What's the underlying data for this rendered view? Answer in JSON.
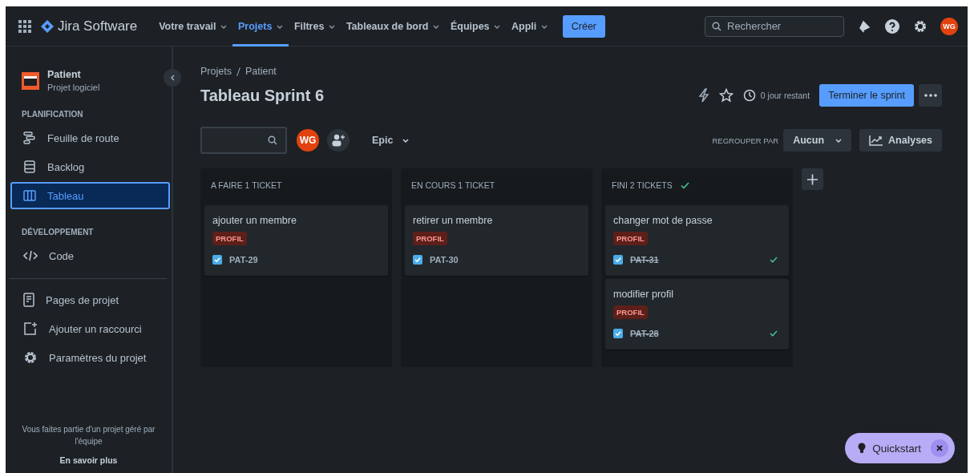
{
  "topbar": {
    "product": "Jira Software",
    "menus": [
      {
        "label": "Votre travail",
        "selected": false
      },
      {
        "label": "Projets",
        "selected": true
      },
      {
        "label": "Filtres",
        "selected": false
      },
      {
        "label": "Tableaux de bord",
        "selected": false
      },
      {
        "label": "Équipes",
        "selected": false
      },
      {
        "label": "Appli",
        "selected": false
      }
    ],
    "create_button": "Créer",
    "search": {
      "placeholder": "Rechercher"
    },
    "avatar": "WG"
  },
  "sidebar": {
    "project": {
      "name": "Patient",
      "type": "Projet logiciel"
    },
    "sections": [
      {
        "heading": "PLANIFICATION",
        "items": [
          {
            "label": "Feuille de route",
            "kind": "roadmap",
            "selected": false
          },
          {
            "label": "Backlog",
            "kind": "backlog",
            "selected": false
          },
          {
            "label": "Tableau",
            "kind": "board",
            "selected": true
          }
        ]
      },
      {
        "heading": "DÉVELOPPEMENT",
        "items": [
          {
            "label": "Code",
            "kind": "code",
            "selected": false
          }
        ]
      }
    ],
    "links": [
      {
        "label": "Pages de projet",
        "kind": "page"
      },
      {
        "label": "Ajouter un raccourci",
        "kind": "shortcut"
      },
      {
        "label": "Paramètres du projet",
        "kind": "settings"
      }
    ],
    "note": "Vous faites partie d'un projet géré par l'équipe",
    "learn_more": "En savoir plus"
  },
  "breadcrumbs": [
    "Projets",
    "Patient"
  ],
  "title": "Tableau Sprint 6",
  "days_left": "0 jour restant",
  "complete_button": "Terminer le sprint",
  "filters": {
    "avatar": "WG",
    "epic": "Epic",
    "group_by_label": "REGROUPER PAR",
    "group_by": "Aucun",
    "insights": "Analyses"
  },
  "columns": [
    {
      "title": "A FAIRE 1 TICKET",
      "done": false,
      "cards": [
        {
          "title": "ajouter un membre",
          "label": "PROFIL",
          "key": "PAT-29",
          "done": false
        }
      ]
    },
    {
      "title": "EN COURS 1 TICKET",
      "done": false,
      "cards": [
        {
          "title": "retirer un membre",
          "label": "PROFIL",
          "key": "PAT-30",
          "done": false
        }
      ]
    },
    {
      "title": "FINI 2 TICKETS",
      "done": true,
      "cards": [
        {
          "title": "changer mot de passe",
          "label": "PROFIL",
          "key": "PAT-31",
          "done": true
        },
        {
          "title": "modifier profil",
          "label": "PROFIL",
          "key": "PAT-28",
          "done": true
        }
      ]
    }
  ],
  "quickstart": "Quickstart"
}
